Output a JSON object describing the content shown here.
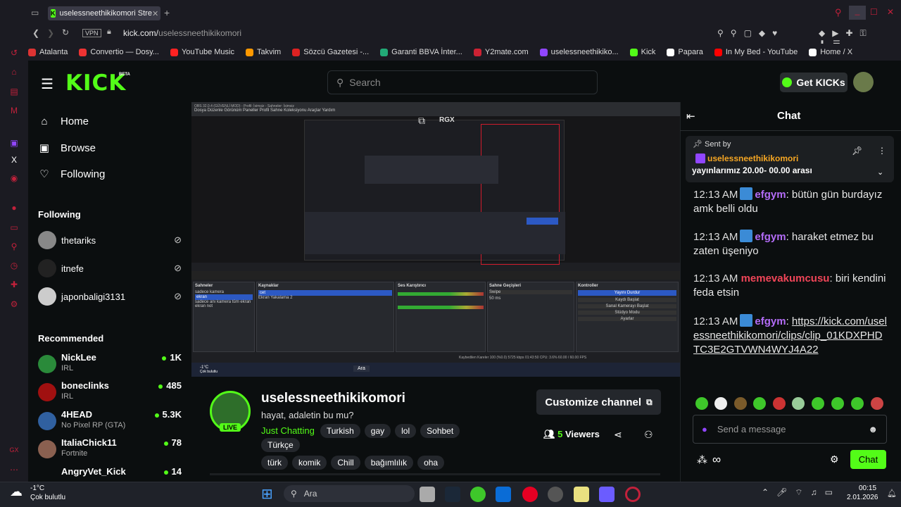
{
  "browser": {
    "tab_title": "uselessneethikikomori Stre",
    "url_prefix": "kick.com/",
    "url_path": "uselessneethikikomori",
    "vpn": "VPN"
  },
  "bookmarks": [
    "Atalanta",
    "Convertio — Dosy...",
    "YouTube Music",
    "Takvim",
    "Sözcü Gazetesi -...",
    "Garanti BBVA İnter...",
    "Y2mate.com",
    "uselessneethikiko...",
    "Kick",
    "Papara",
    "In My Bed - YouTube",
    "Home / X"
  ],
  "bookmark_colors": [
    "#d33",
    "#e33",
    "#f22",
    "#f90",
    "#d22",
    "#2a7",
    "#c23",
    "#9146ff",
    "#53fc18",
    "#fff",
    "#f00",
    "#fff"
  ],
  "kick": {
    "logo": "KICK",
    "beta": "BETA",
    "search_placeholder": "Search",
    "get_kicks": "Get KICKs"
  },
  "nav": {
    "home": "Home",
    "browse": "Browse",
    "following": "Following"
  },
  "following_header": "Following",
  "following": [
    {
      "name": "thetariks"
    },
    {
      "name": "itnefe"
    },
    {
      "name": "japonbaligi3131"
    }
  ],
  "recommended_header": "Recommended",
  "recommended": [
    {
      "name": "NickLee",
      "category": "IRL",
      "viewers": "1K"
    },
    {
      "name": "boneclinks",
      "category": "IRL",
      "viewers": "485"
    },
    {
      "name": "4HEAD",
      "category": "No Pixel RP (GTA)",
      "viewers": "5.3K"
    },
    {
      "name": "ItaliaChick11",
      "category": "Fortnite",
      "viewers": "78"
    },
    {
      "name": "AngryVet_Kick",
      "category": "",
      "viewers": "14"
    }
  ],
  "obs": {
    "title": "OBS 32.0.4 (GÜVENLİ MOD) - Profil: İsimsiz - Sahneler: İsimsiz",
    "menu": "Dosya   Düzenle   Görünüm   Paneller   Profil   Sahne Koleksiyonu   Araçlar   Yardım",
    "scenes_title": "Sahneler",
    "scenes": [
      "sadece kamera",
      "ekran",
      "sadece anı kamera tüm ekran",
      "ekran not"
    ],
    "sources_title": "Kaynaklar",
    "sources": [
      "cet",
      "Ekran Yakalama 2"
    ],
    "mixer_title": "Ses Karıştırıcı",
    "transitions_title": "Sahne Geçişleri",
    "transition": "Swipe",
    "duration": "50 ms",
    "controls_title": "Kontroller",
    "controls": [
      "Yayını Durdur",
      "Kaydı Başlat",
      "Sanal Kamerayı Başlat",
      "Stüdyo Modu",
      "Ayarlar"
    ],
    "status": "Kaybedilen Kareler 100 (%0.0)   5725 kbps   01:43:50   CPU: 3.6%   60.00 / 60.00 FPS",
    "rgx": "RGX",
    "weather": "-1°C",
    "weather_sub": "Çok bulutlu",
    "search": "Ara"
  },
  "channel": {
    "name": "uselessneethikikomori",
    "title": "hayat, adaletin bu mu?",
    "live": "LIVE",
    "category": "Just Chatting",
    "tags": [
      "Turkish",
      "gay",
      "lol",
      "Sohbet",
      "Türkçe",
      "türk",
      "komik",
      "Chill",
      "bağımlılık",
      "oha"
    ],
    "customize": "Customize channel",
    "viewers": "5",
    "viewers_label": "Viewers"
  },
  "chat": {
    "title": "Chat",
    "pinned_by": "Sent by",
    "pinned_user": "uselessneethikikomori",
    "pinned_text": "yayınlarımız 20.00- 00.00 arası",
    "messages": [
      {
        "time": "12:13 AM",
        "user": "efgym",
        "text": "bütün gün burdayız amk belli oldu"
      },
      {
        "time": "12:13 AM",
        "user": "efgym",
        "text": "haraket etmez bu zaten üşeniyo"
      },
      {
        "time": "12:13 AM",
        "user": "memevakumcusu",
        "text": "biri kendini feda etsin"
      },
      {
        "time": "12:13 AM",
        "user": "efgym",
        "text": "https://kick.com/uselessneethikikomori/clips/clip_01KDXPHDTC3E2GTVWN4WYJ4A22"
      }
    ],
    "input_placeholder": "Send a message",
    "send": "Chat"
  },
  "taskbar": {
    "weather": "-1°C",
    "weather_sub": "Çok bulutlu",
    "search": "Ara",
    "time": "00:15",
    "date": "2.01.2026"
  },
  "colors": {
    "kick_green": "#53fc18",
    "opera_red": "#c2213b"
  }
}
